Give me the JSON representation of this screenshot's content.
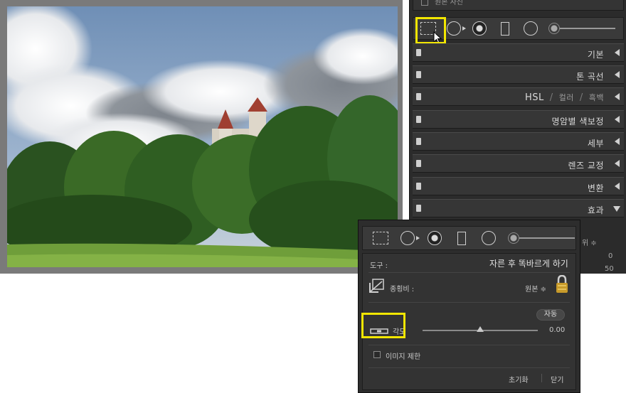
{
  "colors": {
    "highlight": "#f2e600",
    "panel_bg": "#2b2b2b",
    "section_bg": "#363636",
    "text": "#d9d9d9"
  },
  "panel": {
    "original_photo_label": "원본 사진",
    "tools": [
      "crop-overlay-icon",
      "spot-removal-icon",
      "red-eye-icon",
      "graduated-filter-icon",
      "radial-filter-icon",
      "adjustment-brush-slider-icon"
    ],
    "sections": [
      {
        "label": "기본",
        "expanded": false
      },
      {
        "label": "톤 곡선",
        "expanded": false
      },
      {
        "label_parts": [
          "HSL",
          "/",
          "컬러",
          "/",
          "흑백"
        ],
        "expanded": false
      },
      {
        "label": "명암별 색보정",
        "expanded": false
      },
      {
        "label": "세부",
        "expanded": false
      },
      {
        "label": "렌즈 교정",
        "expanded": false
      },
      {
        "label": "변환",
        "expanded": false
      },
      {
        "label": "효과",
        "expanded": true
      }
    ],
    "peek": {
      "dropdown": "위 ≑",
      "value1": "0",
      "value2": "50"
    }
  },
  "crop": {
    "tool_label": "도구 :",
    "tool_value": "자른 후 똑바르게 하기",
    "aspect_label": "종횡비 :",
    "aspect_value": "원본 ≑",
    "auto_button": "자동",
    "angle_label": "각도",
    "angle_value": "0.00",
    "constrain_label": "이미지 제한",
    "reset_button": "초기화",
    "close_button": "닫기"
  }
}
